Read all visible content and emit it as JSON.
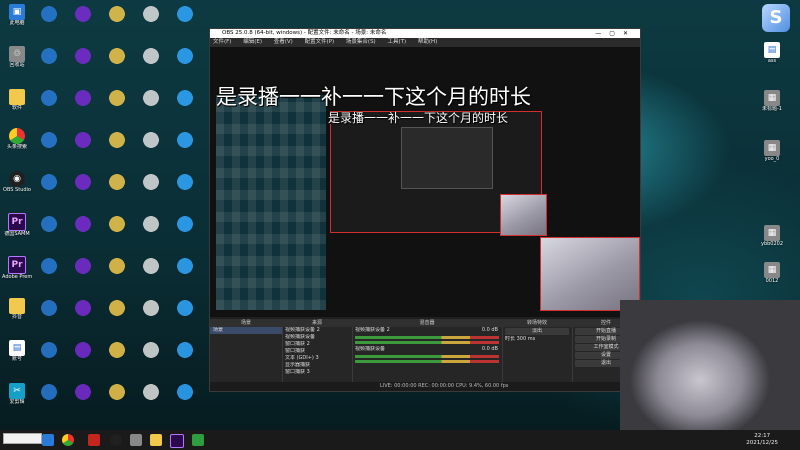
{
  "desktop": {
    "left_icons": [
      {
        "label": "此电脑",
        "icon": "computer-icon"
      },
      {
        "label": "回收站",
        "icon": "recycle-bin-icon"
      },
      {
        "label": "软件",
        "icon": "folder-icon"
      },
      {
        "label": "头条搜索",
        "icon": "browser-icon"
      },
      {
        "label": "OBS Studio",
        "icon": "obs-icon"
      },
      {
        "label": "德国SAMM",
        "icon": "premiere-icon"
      },
      {
        "label": "Adobe Premiere",
        "icon": "premiere-icon"
      },
      {
        "label": "抖音",
        "icon": "folder-icon"
      },
      {
        "label": "账号",
        "icon": "document-icon"
      },
      {
        "label": "爱剪辑",
        "icon": "app-icon"
      }
    ],
    "right_icons": [
      {
        "label": "ass",
        "icon": "document-icon"
      },
      {
        "label": "未标题-1",
        "icon": "image-icon"
      },
      {
        "label": "yoo_0",
        "icon": "image-icon"
      },
      {
        "label": "ybb0202",
        "icon": "image-icon"
      },
      {
        "label": "0012",
        "icon": "image-icon"
      }
    ],
    "right_logo": "S"
  },
  "obs": {
    "title": "OBS 25.0.8 (64-bit, windows) - 配置文件: 未命名 - 场景: 未命名",
    "menu": [
      "文件(F)",
      "编辑(E)",
      "查看(V)",
      "配置文件(P)",
      "场景集合(S)",
      "工具(T)",
      "帮助(H)"
    ],
    "overlay_text": "是录播一一补一一下这个月的时长",
    "docks": {
      "scenes": {
        "title": "场景",
        "items": [
          "场景"
        ]
      },
      "sources": {
        "title": "来源",
        "items": [
          "视频捕获设备 2",
          "视频捕获设备",
          "窗口捕获 2",
          "窗口捕获",
          "文本 (GDI+) 3",
          "显示器捕获",
          "窗口捕获 3"
        ]
      },
      "mixer": {
        "title": "混音器",
        "channels": [
          {
            "name": "视频捕获设备 2",
            "db": "0.0 dB"
          },
          {
            "name": "视频捕获设备",
            "db": "0.0 dB"
          }
        ]
      },
      "transitions": {
        "title": "转场特效",
        "type": "淡出",
        "duration_label": "时长",
        "duration": "300 ms"
      },
      "controls": {
        "title": "控件",
        "buttons": [
          "开始直播",
          "开始录制",
          "工作室模式",
          "设置",
          "退出"
        ]
      }
    },
    "status": "LIVE: 00:00:00   REC: 00:00:00   CPU: 9.4%, 60.00 fps"
  },
  "taskbar": {
    "time": "22:17",
    "date": "2021/12/25",
    "search_text": ""
  }
}
